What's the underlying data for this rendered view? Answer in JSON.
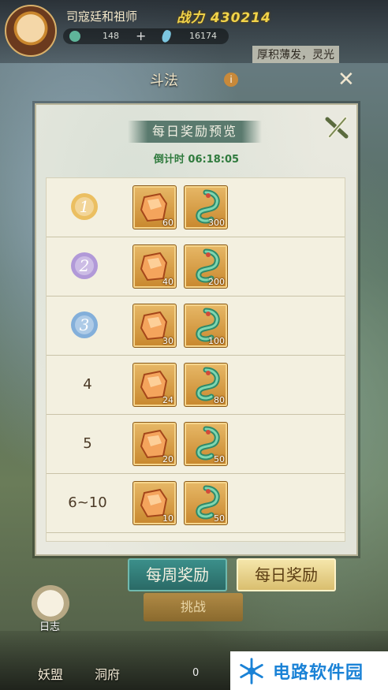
{
  "player": {
    "name": "司寇廷和祖师",
    "power_label": "战力 430214",
    "resource_1": "148",
    "resource_2": "16174",
    "scroll_text": "厚积薄发，灵光"
  },
  "behind_panel": {
    "title": "斗法",
    "info_icon": "i"
  },
  "modal": {
    "title": "每日奖励预览",
    "countdown": "倒计时 06:18:05",
    "rows": [
      {
        "rank": "1",
        "medal": "gold",
        "item1_qty": "60",
        "item2_qty": "300"
      },
      {
        "rank": "2",
        "medal": "purple",
        "item1_qty": "40",
        "item2_qty": "200"
      },
      {
        "rank": "3",
        "medal": "blue",
        "item1_qty": "30",
        "item2_qty": "100"
      },
      {
        "rank": "4",
        "medal": "",
        "item1_qty": "24",
        "item2_qty": "80"
      },
      {
        "rank": "5",
        "medal": "",
        "item1_qty": "20",
        "item2_qty": "50"
      },
      {
        "rank": "6~10",
        "medal": "",
        "item1_qty": "10",
        "item2_qty": "50"
      }
    ]
  },
  "tabs": {
    "weekly": "每周奖励",
    "daily": "每日奖励"
  },
  "buttons": {
    "challenge": "挑战"
  },
  "bottom": {
    "log_label": "日志",
    "nav_alliance": "妖盟",
    "nav_cave": "洞府",
    "coin_count": "0"
  },
  "watermark": {
    "text": "电路软件园"
  },
  "colors": {
    "gold_medal": "#e9b64a",
    "purple_medal": "#a58ad6",
    "blue_medal": "#6fa3d8",
    "accent_green": "#2f7a3d"
  }
}
